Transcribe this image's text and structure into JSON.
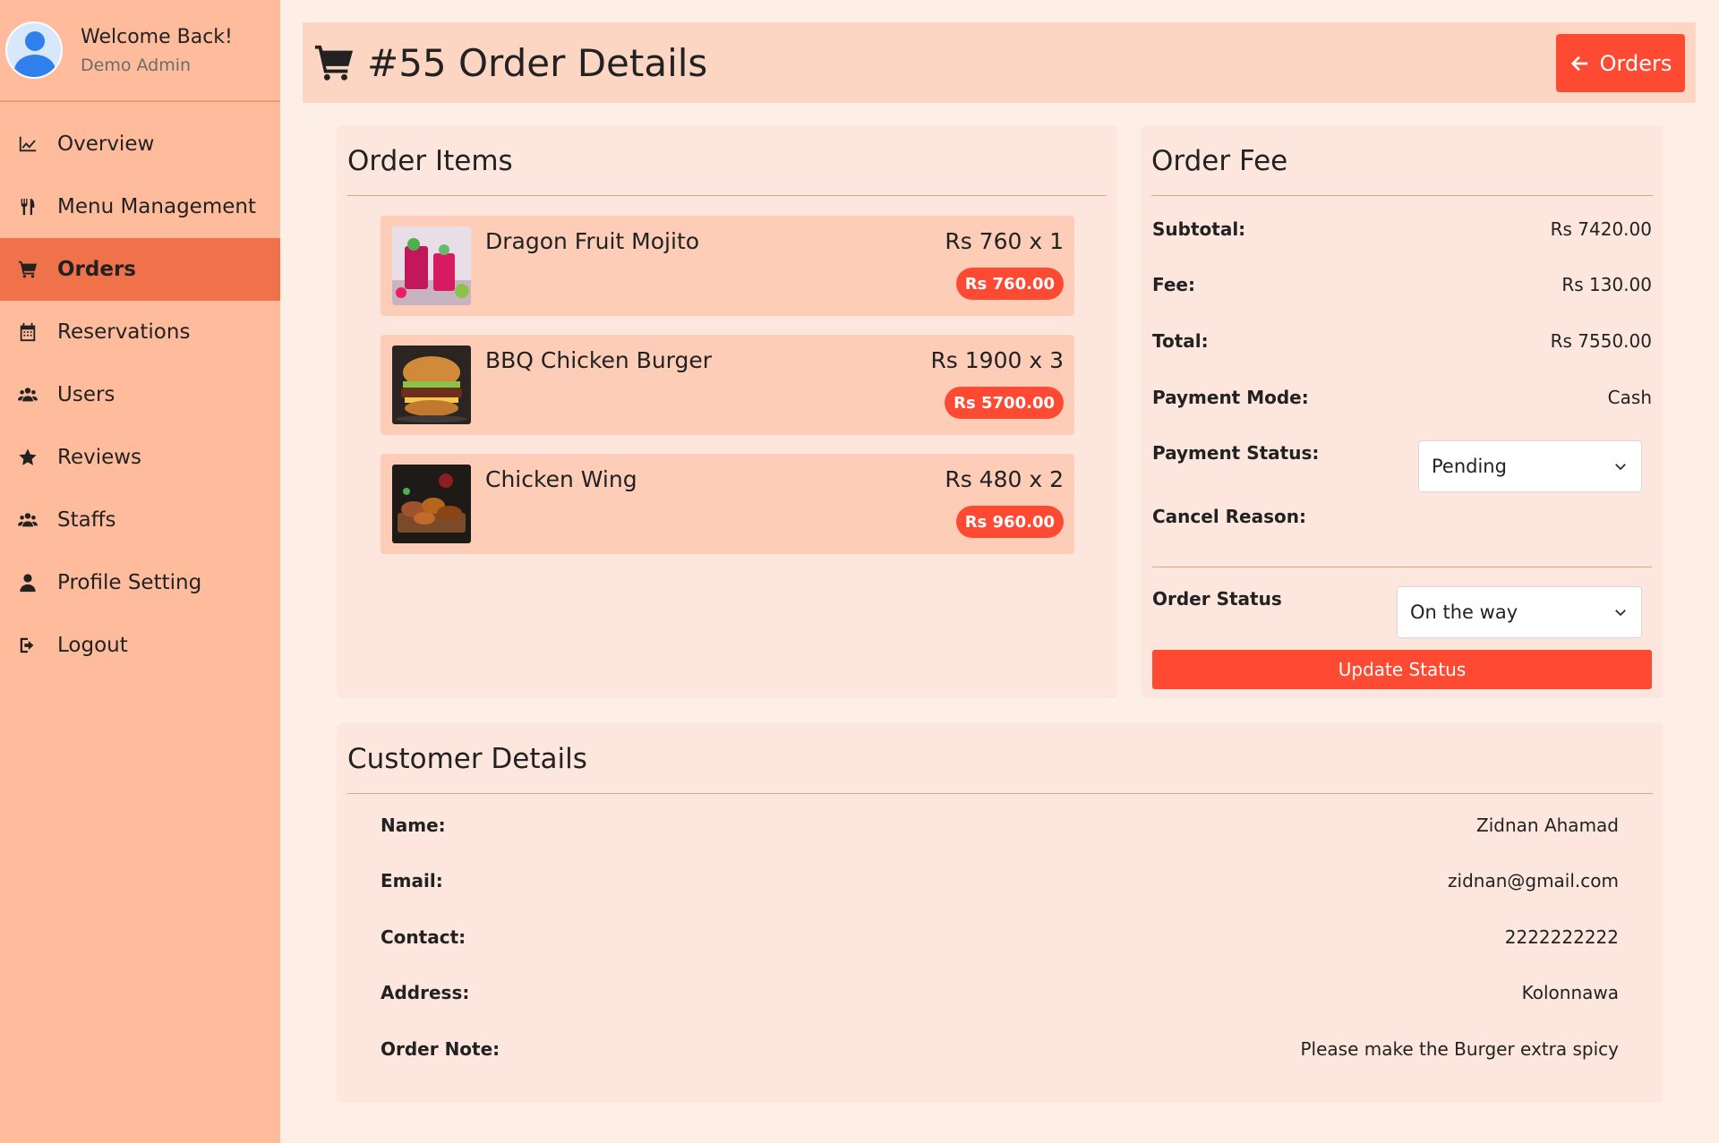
{
  "sidebar": {
    "welcome": "Welcome Back!",
    "user_name": "Demo Admin",
    "items": [
      {
        "label": "Overview",
        "icon": "chart-line-icon"
      },
      {
        "label": "Menu Management",
        "icon": "utensils-icon"
      },
      {
        "label": "Orders",
        "icon": "cart-icon",
        "active": true
      },
      {
        "label": "Reservations",
        "icon": "calendar-icon"
      },
      {
        "label": "Users",
        "icon": "users-icon"
      },
      {
        "label": "Reviews",
        "icon": "star-icon"
      },
      {
        "label": "Staffs",
        "icon": "users-icon"
      },
      {
        "label": "Profile Setting",
        "icon": "user-icon"
      },
      {
        "label": "Logout",
        "icon": "logout-icon"
      }
    ]
  },
  "header": {
    "title": "#55 Order Details",
    "back_button": "Orders"
  },
  "order_items": {
    "title": "Order Items",
    "items": [
      {
        "name": "Dragon Fruit Mojito",
        "qty": "Rs 760 x 1",
        "total": "Rs 760.00"
      },
      {
        "name": "BBQ Chicken Burger",
        "qty": "Rs 1900 x 3",
        "total": "Rs 5700.00"
      },
      {
        "name": "Chicken Wing",
        "qty": "Rs 480 x 2",
        "total": "Rs 960.00"
      }
    ]
  },
  "order_fee": {
    "title": "Order Fee",
    "subtotal_label": "Subtotal:",
    "subtotal": "Rs 7420.00",
    "fee_label": "Fee:",
    "fee": "Rs 130.00",
    "total_label": "Total:",
    "total": "Rs 7550.00",
    "payment_mode_label": "Payment Mode:",
    "payment_mode": "Cash",
    "payment_status_label": "Payment Status:",
    "payment_status": "Pending",
    "cancel_reason_label": "Cancel Reason:",
    "order_status_label": "Order Status",
    "order_status": "On the way",
    "update_button": "Update Status"
  },
  "customer": {
    "title": "Customer Details",
    "name_label": "Name:",
    "name": "Zidnan Ahamad",
    "email_label": "Email:",
    "email": "zidnan@gmail.com",
    "contact_label": "Contact:",
    "contact": "2222222222",
    "address_label": "Address:",
    "address": "Kolonnawa",
    "note_label": "Order Note:",
    "note": "Please make the Burger extra spicy"
  },
  "colors": {
    "sidebar_bg": "#ffbc9c",
    "active_nav": "#f0724a",
    "accent": "#ff4a33",
    "page_bg": "#fdefe6",
    "card_bg": "#fde6dd",
    "item_bg": "#fdcdb8"
  }
}
